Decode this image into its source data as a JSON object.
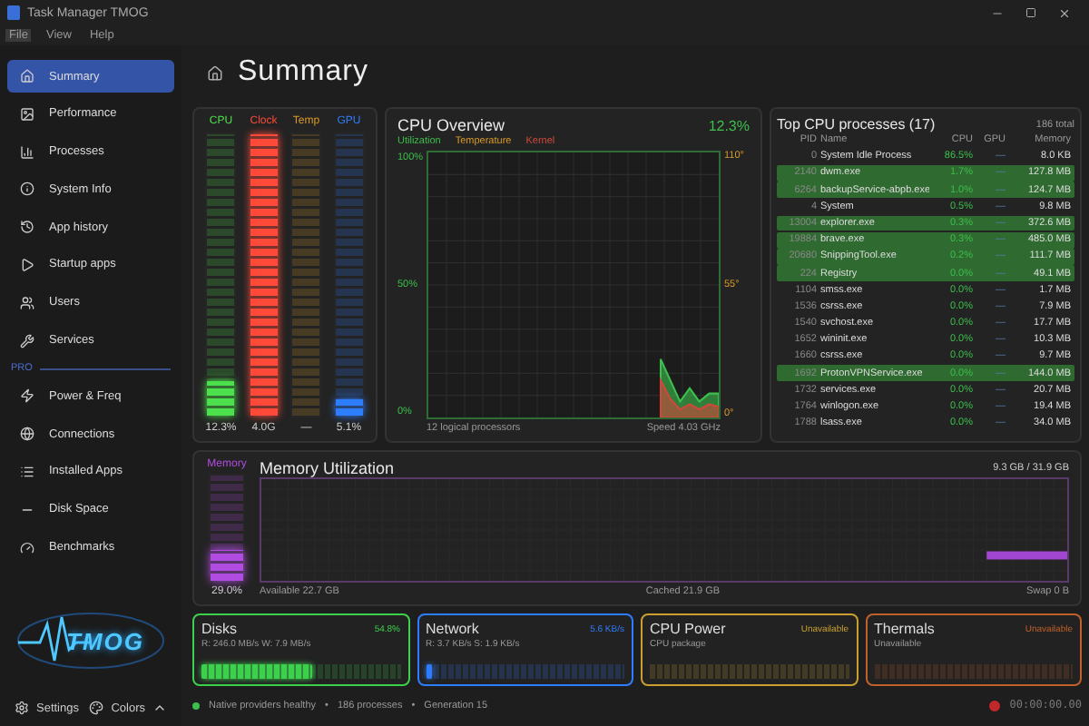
{
  "window": {
    "title": "Task Manager TMOG"
  },
  "menu": [
    {
      "label": "File",
      "selected": true
    },
    {
      "label": "View",
      "selected": false
    },
    {
      "label": "Help",
      "selected": false
    }
  ],
  "sidebar": {
    "items": [
      {
        "label": "Summary",
        "selected": true
      },
      {
        "label": "Performance",
        "selected": false
      },
      {
        "label": "Processes",
        "selected": false
      },
      {
        "label": "System Info",
        "selected": false
      },
      {
        "label": "App history",
        "selected": false
      },
      {
        "label": "Startup apps",
        "selected": false
      },
      {
        "label": "Users",
        "selected": false
      },
      {
        "label": "Services",
        "selected": false
      }
    ],
    "section": "PRO",
    "pro_items": [
      {
        "label": "Power & Freq",
        "selected": false
      },
      {
        "label": "Connections",
        "selected": false
      },
      {
        "label": "Installed Apps",
        "selected": false
      },
      {
        "label": "Disk Space",
        "selected": false
      },
      {
        "label": "Benchmarks",
        "selected": false
      }
    ],
    "logo": "TMOG",
    "footer": [
      "Settings",
      "Colors"
    ]
  },
  "page": {
    "title": "Summary"
  },
  "meters": [
    {
      "label": "CPU",
      "color": "#4ce04c",
      "level": 0.123,
      "reading": "12.3%"
    },
    {
      "label": "Clock",
      "color": "#ff4a3a",
      "level": 1,
      "reading": "4.0G"
    },
    {
      "label": "Temp",
      "color": "#d89a28",
      "level": 0,
      "reading": "—"
    },
    {
      "label": "GPU",
      "color": "#2f7dff",
      "level": 0.06,
      "reading": "5.1%"
    }
  ],
  "cpu_overview": {
    "title": "CPU Overview",
    "usage": "12.3%",
    "temperature_legend": "Temperature",
    "right_ticks": [
      "110°",
      "55°",
      "0°"
    ],
    "processors": "12 logical processors",
    "speed": "Speed 4.03 GHz",
    "chart_data": {
      "type": "area",
      "grid": true,
      "ylim": [
        0,
        100
      ],
      "yticks": [
        {
          "value": 0,
          "label": "0%"
        },
        {
          "value": 50,
          "label": "50%"
        },
        {
          "value": 100,
          "label": "100%"
        }
      ],
      "series": [
        {
          "name": "Utilization",
          "color": "#3cbf4c",
          "values": [
            null,
            null,
            null,
            null,
            null,
            null,
            null,
            null,
            null,
            null,
            null,
            null,
            null,
            null,
            null,
            null,
            null,
            null,
            null,
            null,
            null,
            null,
            null,
            null,
            22,
            14,
            6,
            11,
            6,
            9,
            9
          ]
        },
        {
          "name": "Kernel",
          "color": "#d0483c",
          "values": [
            null,
            null,
            null,
            null,
            null,
            null,
            null,
            null,
            null,
            null,
            null,
            null,
            null,
            null,
            null,
            null,
            null,
            null,
            null,
            null,
            null,
            null,
            null,
            null,
            14,
            7,
            3,
            5,
            3,
            5,
            4
          ]
        }
      ]
    }
  },
  "processes": {
    "title": "Top CPU processes (17)",
    "total": "186 total",
    "columns": [
      "PID",
      "Name",
      "CPU",
      "GPU",
      "Memory"
    ],
    "rows": [
      {
        "pid": "0",
        "name": "System Idle Process",
        "cpu": "86.5%",
        "gpu": "—",
        "memory": "8.0 KB",
        "highlighted": false
      },
      {
        "pid": "2140",
        "name": "dwm.exe",
        "cpu": "1.7%",
        "gpu": "—",
        "memory": "127.8 MB",
        "highlighted": true
      },
      {
        "pid": "6264",
        "name": "backupService-abpb.exe",
        "cpu": "1.0%",
        "gpu": "—",
        "memory": "124.7 MB",
        "highlighted": true
      },
      {
        "pid": "4",
        "name": "System",
        "cpu": "0.5%",
        "gpu": "—",
        "memory": "9.8 MB",
        "highlighted": false
      },
      {
        "pid": "13004",
        "name": "explorer.exe",
        "cpu": "0.3%",
        "gpu": "—",
        "memory": "372.6 MB",
        "highlighted": true
      },
      {
        "pid": "19884",
        "name": "brave.exe",
        "cpu": "0.3%",
        "gpu": "—",
        "memory": "485.0 MB",
        "highlighted": true
      },
      {
        "pid": "20680",
        "name": "SnippingTool.exe",
        "cpu": "0.2%",
        "gpu": "—",
        "memory": "111.7 MB",
        "highlighted": true
      },
      {
        "pid": "224",
        "name": "Registry",
        "cpu": "0.0%",
        "gpu": "—",
        "memory": "49.1 MB",
        "highlighted": true
      },
      {
        "pid": "1104",
        "name": "smss.exe",
        "cpu": "0.0%",
        "gpu": "—",
        "memory": "1.7 MB",
        "highlighted": false
      },
      {
        "pid": "1536",
        "name": "csrss.exe",
        "cpu": "0.0%",
        "gpu": "—",
        "memory": "7.9 MB",
        "highlighted": false
      },
      {
        "pid": "1540",
        "name": "svchost.exe",
        "cpu": "0.0%",
        "gpu": "—",
        "memory": "17.7 MB",
        "highlighted": false
      },
      {
        "pid": "1652",
        "name": "wininit.exe",
        "cpu": "0.0%",
        "gpu": "—",
        "memory": "10.3 MB",
        "highlighted": false
      },
      {
        "pid": "1660",
        "name": "csrss.exe",
        "cpu": "0.0%",
        "gpu": "—",
        "memory": "9.7 MB",
        "highlighted": false
      },
      {
        "pid": "1692",
        "name": "ProtonVPNService.exe",
        "cpu": "0.0%",
        "gpu": "—",
        "memory": "144.0 MB",
        "highlighted": true
      },
      {
        "pid": "1732",
        "name": "services.exe",
        "cpu": "0.0%",
        "gpu": "—",
        "memory": "20.7 MB",
        "highlighted": false
      },
      {
        "pid": "1764",
        "name": "winlogon.exe",
        "cpu": "0.0%",
        "gpu": "—",
        "memory": "19.4 MB",
        "highlighted": false
      },
      {
        "pid": "1788",
        "name": "lsass.exe",
        "cpu": "0.0%",
        "gpu": "—",
        "memory": "34.0 MB",
        "highlighted": false
      }
    ]
  },
  "memory": {
    "label": "Memory",
    "color": "#b04ce0",
    "level": 0.29,
    "reading": "29.0%",
    "title": "Memory Utilization",
    "usage": "9.3 GB / 31.9 GB",
    "available": "Available 22.7 GB",
    "cached": "Cached 21.9 GB",
    "swap": "Swap 0 B"
  },
  "cards": [
    {
      "title": "Disks",
      "status": "54.8%",
      "detail": "R: 246.0 MB/s  W: 7.9 MB/s",
      "color": "#3cd04c",
      "level": 0.56
    },
    {
      "title": "Network",
      "status": "5.6 KB/s",
      "detail": "R: 3.7 KB/s  S: 1.9 KB/s",
      "color": "#2f7dff",
      "level": 0.03
    },
    {
      "title": "CPU Power",
      "status": "Unavailable",
      "detail": "CPU package",
      "color": "#c9a030"
    },
    {
      "title": "Thermals",
      "status": "Unavailable",
      "detail": "Unavailable",
      "color": "#c0602a"
    }
  ],
  "status_bar": {
    "items": [
      "Native providers healthy",
      "186 processes",
      "Generation 15"
    ],
    "separators": [
      "•",
      "•"
    ],
    "timer": "00:00:00.00"
  }
}
